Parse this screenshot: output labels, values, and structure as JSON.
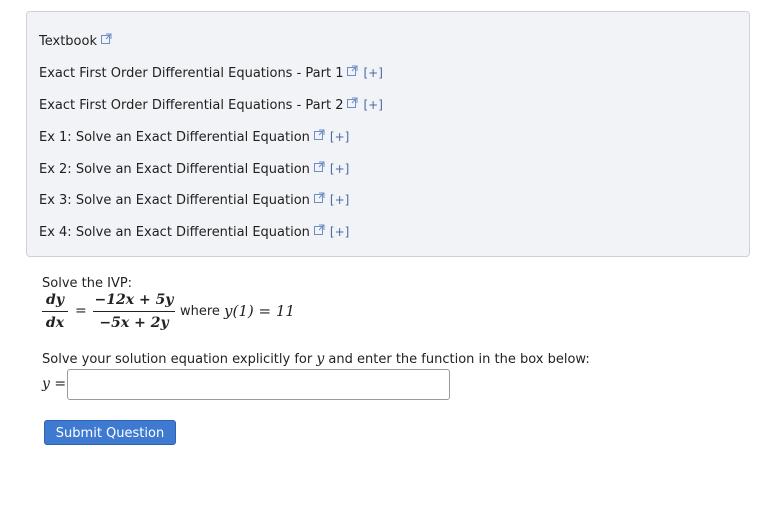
{
  "help_links": [
    {
      "label": "Textbook",
      "expand": ""
    },
    {
      "label": "Exact First Order Differential Equations - Part 1",
      "expand": "[+]"
    },
    {
      "label": "Exact First Order Differential Equations - Part 2",
      "expand": "[+]"
    },
    {
      "label": "Ex 1: Solve an Exact Differential Equation",
      "expand": "[+]"
    },
    {
      "label": "Ex 2: Solve an Exact Differential Equation",
      "expand": "[+]"
    },
    {
      "label": "Ex 3: Solve an Exact Differential Equation",
      "expand": "[+]"
    },
    {
      "label": "Ex 4: Solve an Exact Differential Equation",
      "expand": "[+]"
    }
  ],
  "problem": {
    "intro": "Solve the IVP:",
    "lhs_num": "dy",
    "lhs_den": "dx",
    "equals": "=",
    "rhs_num": "−12x + 5y",
    "rhs_den": "−5x + 2y",
    "where_text": "where",
    "initial_condition": "y(1) = 11",
    "instruction_pre": "Solve your solution equation explicitly for",
    "instruction_var": "y",
    "instruction_post": "and enter the function in the box below:",
    "answer_label": "y =",
    "answer_value": ""
  },
  "submit_label": "Submit Question",
  "colors": {
    "button": "#3f7ad1",
    "panel_bg": "#f2f3f7",
    "expand": "#4a6aa0"
  }
}
